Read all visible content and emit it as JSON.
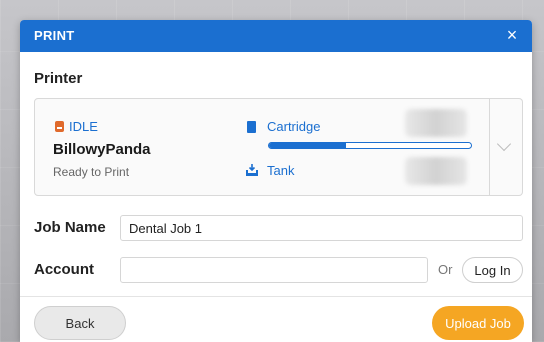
{
  "dialog": {
    "title": "PRINT",
    "close_label": "×"
  },
  "printer_section": {
    "heading": "Printer",
    "status": "IDLE",
    "name": "BillowyPanda",
    "subtitle": "Ready to Print",
    "cartridge_label": "Cartridge",
    "cartridge_level_percent": 38,
    "tank_label": "Tank"
  },
  "job": {
    "label": "Job Name",
    "value": "Dental Job 1"
  },
  "account": {
    "label": "Account",
    "value": "",
    "or_text": "Or",
    "login_label": "Log In"
  },
  "footer": {
    "back_label": "Back",
    "upload_label": "Upload Job"
  },
  "colors": {
    "accent": "#1b6fd0",
    "status_orange": "#e06a2c",
    "upload_button": "#f5a623"
  },
  "icons": {
    "status": "printer-status-icon",
    "cartridge": "cartridge-icon",
    "tank": "tank-icon",
    "dropdown": "chevron-down-icon",
    "close": "close-icon"
  }
}
